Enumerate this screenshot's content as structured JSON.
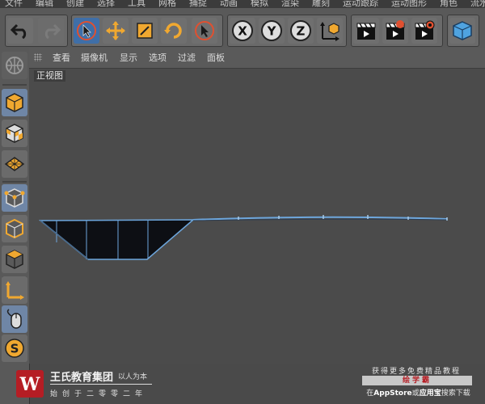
{
  "menu": {
    "items": [
      "文件",
      "编辑",
      "创建",
      "选择",
      "工具",
      "网格",
      "捕捉",
      "动画",
      "模拟",
      "渲染",
      "雕刻",
      "运动跟踪",
      "运动图形",
      "角色",
      "流水线"
    ]
  },
  "toolbar": {
    "undo_icon": "undo-icon",
    "redo_icon": "redo-icon",
    "axis_x_label": "X",
    "axis_y_label": "Y",
    "axis_z_label": "Z"
  },
  "viewport": {
    "menu": [
      "查看",
      "摄像机",
      "显示",
      "选项",
      "过滤",
      "面板"
    ],
    "view_name": "正视图",
    "model_color": "#6da6dc",
    "background": "#4b4b4b"
  },
  "watermark_left": {
    "logo_letter": "W",
    "title": "王氏教育集团",
    "slogan": "以人为本",
    "founded": "始创于二零零二年"
  },
  "watermark_right": {
    "line1": "获得更多免费精品教程",
    "app_name": "绘学霸",
    "line3_prefix": "在",
    "line3_store": "AppStore",
    "line3_middle": "或",
    "line3_store2": "应用宝",
    "line3_suffix": "搜索下载"
  },
  "colors": {
    "accent_blue": "#3f6fa8",
    "axis_orange": "#f0a830",
    "brand_red": "#b51d24"
  }
}
